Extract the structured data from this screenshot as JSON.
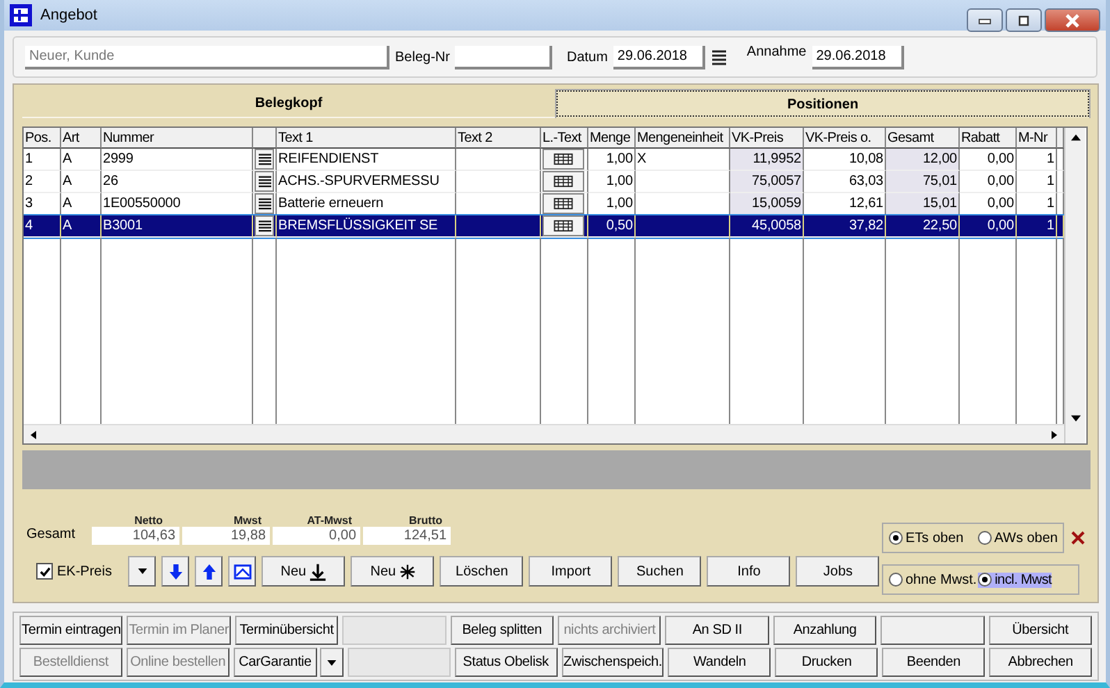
{
  "window": {
    "title": "Angebot"
  },
  "header": {
    "customer": {
      "placeholder": "Neuer, Kunde"
    },
    "beleg_nr": {
      "label": "Beleg-Nr"
    },
    "datum": {
      "label": "Datum",
      "value": "29.06.2018"
    },
    "annahme": {
      "label": "Annahme",
      "value": "29.06.2018"
    }
  },
  "tabs": [
    {
      "label": "Belegkopf",
      "selected": false
    },
    {
      "label": "Positionen",
      "selected": true
    }
  ],
  "table": {
    "columns": [
      {
        "label": "Pos.",
        "kind": "text"
      },
      {
        "label": "Art",
        "kind": "text"
      },
      {
        "label": "Nummer",
        "kind": "text"
      },
      {
        "kind": "list-button"
      },
      {
        "label": "Text 1",
        "kind": "text"
      },
      {
        "label": "Text 2",
        "kind": "text"
      },
      {
        "label": "L.-Text",
        "kind": "grid-button"
      },
      {
        "label": "Menge",
        "kind": "number"
      },
      {
        "label": "Mengeneinheit",
        "kind": "text"
      },
      {
        "label": "VK-Preis",
        "kind": "shaded-number"
      },
      {
        "label": "VK-Preis o.",
        "kind": "number"
      },
      {
        "label": "Gesamt",
        "kind": "shaded-number"
      },
      {
        "label": "Rabatt",
        "kind": "number"
      },
      {
        "label": "M-Nr",
        "kind": "number"
      },
      {
        "kind": "filler"
      }
    ],
    "rows": [
      {
        "selected": false,
        "cells": [
          "1",
          "A",
          "2999",
          null,
          "REIFENDIENST",
          null,
          null,
          "1,00",
          "X",
          "11,9952",
          "10,08",
          "12,00",
          "0,00",
          "1",
          null
        ]
      },
      {
        "selected": false,
        "cells": [
          "2",
          "A",
          "26",
          null,
          "ACHS.-SPURVERMESSU",
          null,
          null,
          "1,00",
          null,
          "75,0057",
          "63,03",
          "75,01",
          "0,00",
          "1",
          null
        ]
      },
      {
        "selected": false,
        "cells": [
          "3",
          "A",
          "1E00550000",
          null,
          "Batterie erneuern",
          null,
          null,
          "1,00",
          null,
          "15,0059",
          "12,61",
          "15,01",
          "0,00",
          "1",
          null
        ]
      },
      {
        "selected": true,
        "cells": [
          "4",
          "A",
          "B3001",
          null,
          "BREMSFLÜSSIGKEIT SE",
          null,
          null,
          "0,50",
          null,
          "45,0058",
          "37,82",
          "22,50",
          "0,00",
          "1",
          null
        ]
      }
    ]
  },
  "totals": {
    "label": "Gesamt",
    "fields": [
      {
        "label": "Netto",
        "value": "104,63"
      },
      {
        "label": "Mwst",
        "value": "19,88"
      },
      {
        "label": "AT-Mwst",
        "value": "0,00"
      },
      {
        "label": "Brutto",
        "value": "124,51"
      }
    ]
  },
  "ek_preis": {
    "label": "EK-Preis",
    "checked": true
  },
  "toolbar": [
    {
      "kind": "dropdown"
    },
    {
      "kind": "down"
    },
    {
      "kind": "up"
    },
    {
      "kind": "image"
    },
    {
      "kind": "insert-below",
      "label": "Neu"
    },
    {
      "kind": "insert",
      "label": "Neu"
    },
    {
      "kind": "text",
      "label": "Löschen"
    },
    {
      "kind": "text",
      "label": "Import"
    },
    {
      "kind": "text",
      "label": "Suchen"
    },
    {
      "kind": "text",
      "label": "Info"
    },
    {
      "kind": "text",
      "label": "Jobs"
    }
  ],
  "order_radios": [
    {
      "label": "ETs oben",
      "selected": true
    },
    {
      "label": "AWs oben",
      "selected": false
    }
  ],
  "tax_radios": [
    {
      "label": "ohne Mwst.",
      "selected": false
    },
    {
      "label": "incl. Mwst",
      "selected": true
    }
  ],
  "bottom_buttons": [
    [
      {
        "kind": "button",
        "label": "Termin eintragen",
        "disabled": false
      },
      {
        "kind": "button",
        "label": "Termin im Planer",
        "disabled": true
      },
      {
        "kind": "button",
        "label": "Terminübersicht",
        "disabled": false
      },
      {
        "kind": "blank",
        "disabled": true
      },
      {
        "kind": "button",
        "label": "Beleg splitten",
        "disabled": false
      },
      {
        "kind": "button",
        "label": "nichts archiviert",
        "disabled": true
      },
      {
        "kind": "button",
        "label": "An SD II",
        "disabled": false
      },
      {
        "kind": "button",
        "label": "Anzahlung",
        "disabled": false
      },
      {
        "kind": "blank",
        "disabled": false
      },
      {
        "kind": "button",
        "label": "Übersicht",
        "disabled": false
      }
    ],
    [
      {
        "kind": "button",
        "label": "Bestelldienst",
        "disabled": true
      },
      {
        "kind": "button",
        "label": "Online bestellen",
        "disabled": true
      },
      {
        "kind": "split",
        "label": "CarGarantie",
        "disabled": false
      },
      {
        "kind": "blank",
        "disabled": true
      },
      {
        "kind": "button",
        "label": "Status Obelisk",
        "disabled": false
      },
      {
        "kind": "button",
        "label": "Zwischenspeich.",
        "disabled": false
      },
      {
        "kind": "button",
        "label": "Wandeln",
        "disabled": false
      },
      {
        "kind": "button",
        "label": "Drucken",
        "disabled": false
      },
      {
        "kind": "button",
        "label": "Beenden",
        "disabled": false
      },
      {
        "kind": "button",
        "label": "Abbrechen",
        "disabled": false
      }
    ]
  ]
}
